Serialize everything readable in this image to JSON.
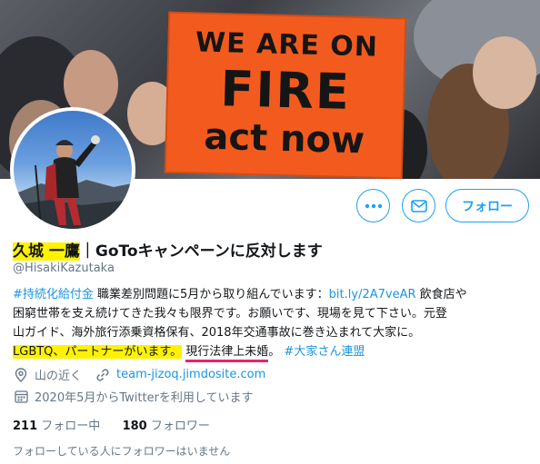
{
  "banner": {
    "sign_line1": "WE ARE ON",
    "sign_line2": "FIRE",
    "sign_line3": "act now"
  },
  "actions": {
    "more_icon": "more-icon",
    "message_icon": "mail-icon",
    "follow_label": "フォロー"
  },
  "profile": {
    "name_highlight": "久城 一鷹",
    "name_rest": "｜GoToキャンペーンに反対します",
    "handle": "@HisakiKazutaka",
    "bio": {
      "line1_tag": "#持続化給付金",
      "line1_text": " 職業差別問題に5月から取り組んでいます：",
      "line1_link": "bit.ly/2A7veAR",
      "line1_tail": " 飲食店や",
      "line2": "困窮世帯を支え続けてきた我々も限界です。お願いです、現場を見て下さい。元登",
      "line3": "山ガイド、海外旅行添乗資格保有、2018年交通事故に巻き込まれて大家に。",
      "line4_highlight": "LGBTQ、パートナーがいます。",
      "line4_underlined": "現行法律上未婚",
      "line4_dot": "。",
      "line4_tag": "#大家さん連盟"
    },
    "location": "山の近く",
    "website": "team-jizoq.jimdosite.com",
    "joined": "2020年5月からTwitterを利用しています",
    "following_count": "211",
    "following_label": "フォロー中",
    "followers_count": "180",
    "followers_label": "フォロワー",
    "followers_note": "フォローしている人にフォロワーはいません"
  },
  "colors": {
    "accent": "#1da1f2",
    "highlight": "#fff200",
    "underline": "#e8246e",
    "sign": "#f35b1e"
  }
}
